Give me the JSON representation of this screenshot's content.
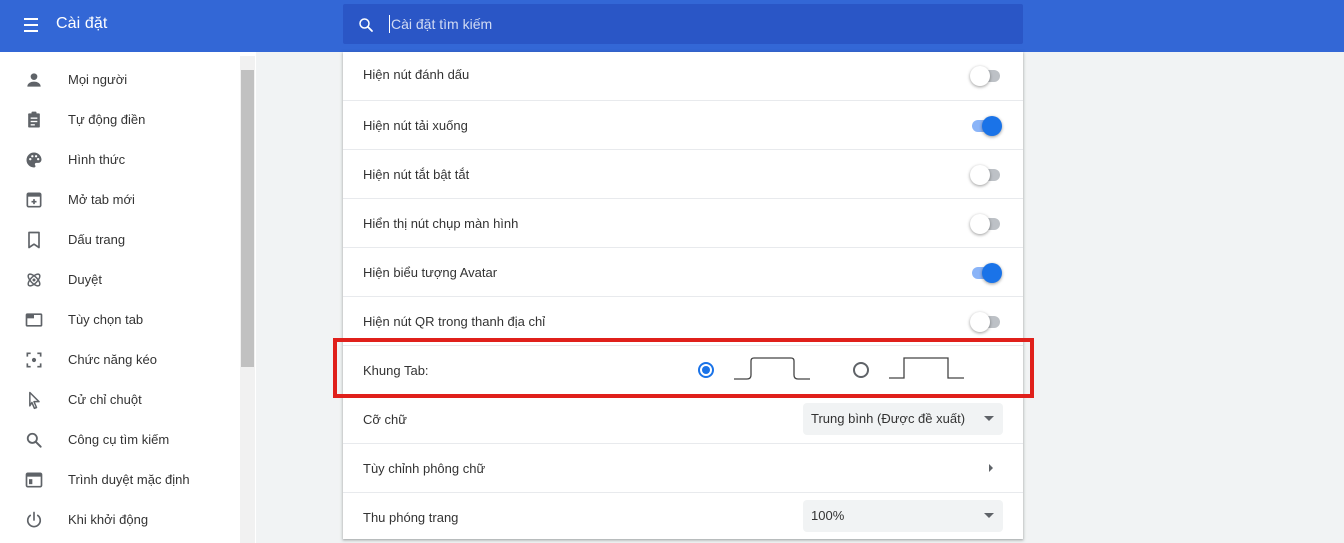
{
  "header": {
    "title": "Cài đặt",
    "search_placeholder": "Cài đặt tìm kiếm"
  },
  "sidebar": {
    "items": [
      {
        "label": "Mọi người",
        "icon": "person-icon"
      },
      {
        "label": "Tự động điền",
        "icon": "clipboard-icon"
      },
      {
        "label": "Hình thức",
        "icon": "palette-icon"
      },
      {
        "label": "Mở tab mới",
        "icon": "new-tab-icon"
      },
      {
        "label": "Dấu trang",
        "icon": "bookmark-icon"
      },
      {
        "label": "Duyệt",
        "icon": "atom-icon"
      },
      {
        "label": "Tùy chọn tab",
        "icon": "tab-icon"
      },
      {
        "label": "Chức năng kéo",
        "icon": "drag-icon"
      },
      {
        "label": "Cử chỉ chuột",
        "icon": "cursor-icon"
      },
      {
        "label": "Công cụ tìm kiếm",
        "icon": "search-icon"
      },
      {
        "label": "Trình duyệt mặc định",
        "icon": "browser-icon"
      },
      {
        "label": "Khi khởi động",
        "icon": "power-icon"
      }
    ]
  },
  "settings": {
    "toggles": [
      {
        "label": "Hiện nút đánh dấu",
        "on": false
      },
      {
        "label": "Hiện nút tải xuống",
        "on": true
      },
      {
        "label": "Hiện nút tắt bật tắt",
        "on": false
      },
      {
        "label": "Hiển thị nút chụp màn hình",
        "on": false
      },
      {
        "label": "Hiện biểu tượng Avatar",
        "on": true
      },
      {
        "label": "Hiện nút QR trong thanh địa chỉ",
        "on": false
      }
    ],
    "tab_frame": {
      "label": "Khung Tab:",
      "selected_option": 1
    },
    "font_size": {
      "label": "Cỡ chữ",
      "value": "Trung bình (Được đề xuất)"
    },
    "customize_fonts": {
      "label": "Tùy chỉnh phông chữ"
    },
    "page_zoom": {
      "label": "Thu phóng trang",
      "value": "100%"
    }
  },
  "colors": {
    "header": "#3367d6",
    "search": "#2a56c6",
    "accent": "#1a73e8",
    "highlight": "#e0201b"
  }
}
